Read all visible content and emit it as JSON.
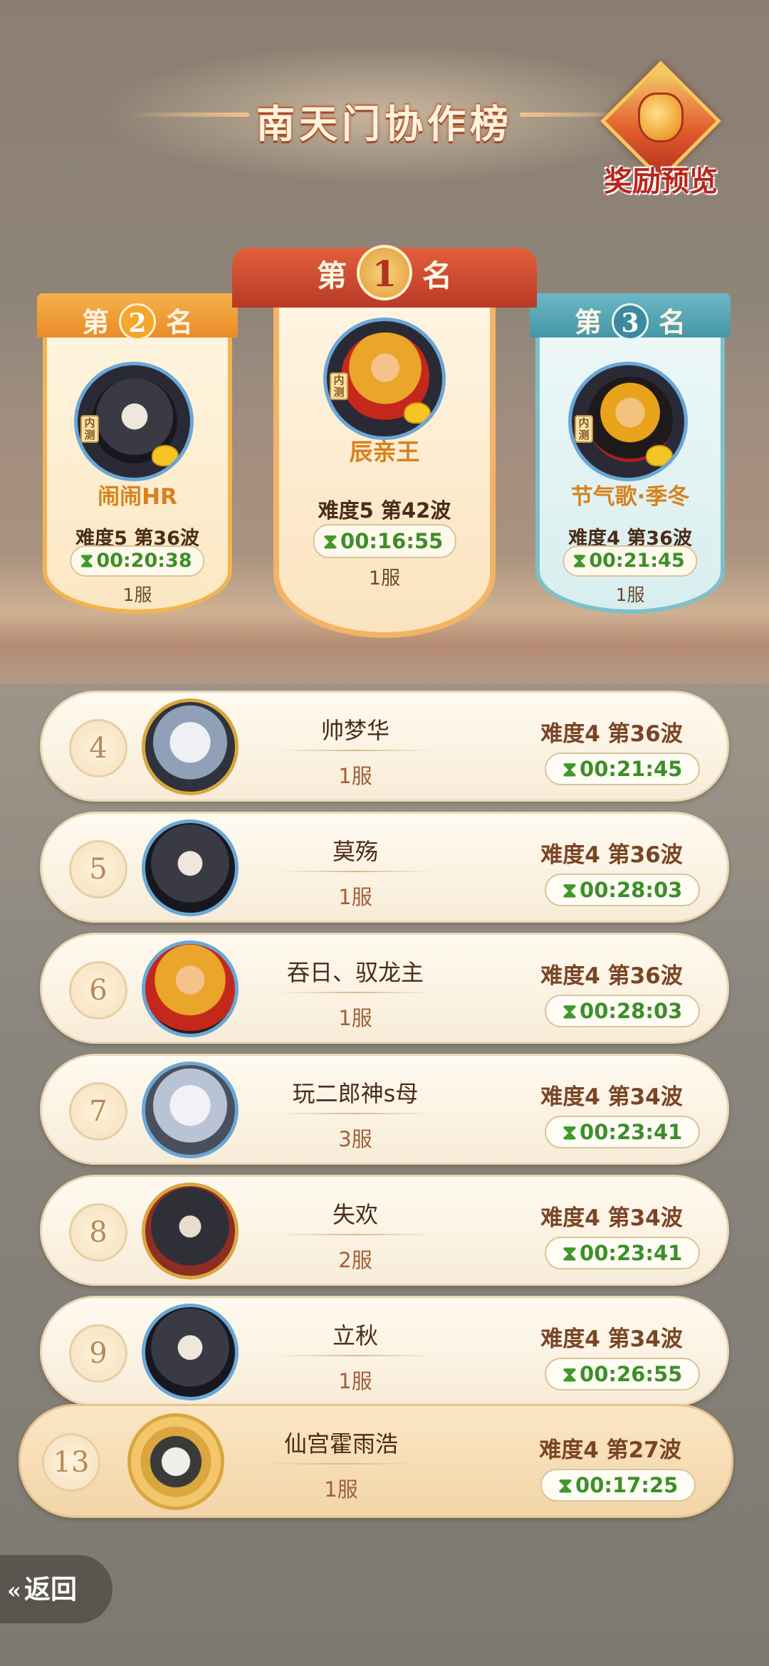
{
  "header": {
    "title": "南天门协作榜",
    "reward_label": "奖励预览"
  },
  "podium": {
    "first": {
      "rank_prefix": "第",
      "rank_num": "1",
      "rank_suffix": "名",
      "name": "辰亲王",
      "info": "难度5 第42波",
      "time": "00:16:55",
      "server": "1服"
    },
    "second": {
      "rank_prefix": "第",
      "rank_num": "2",
      "rank_suffix": "名",
      "name": "闹闹HR",
      "info": "难度5 第36波",
      "time": "00:20:38",
      "server": "1服"
    },
    "third": {
      "rank_prefix": "第",
      "rank_num": "3",
      "rank_suffix": "名",
      "name": "节气歌·季冬",
      "info": "难度4 第36波",
      "time": "00:21:45",
      "server": "1服"
    }
  },
  "avatar_tag": "内测",
  "hourglass_glyph": "⧗",
  "rows": [
    {
      "rank": "4",
      "name": "帅梦华",
      "server": "1服",
      "difficulty": "难度4 第36波",
      "time": "00:21:45"
    },
    {
      "rank": "5",
      "name": "莫殇",
      "server": "1服",
      "difficulty": "难度4 第36波",
      "time": "00:28:03"
    },
    {
      "rank": "6",
      "name": "吞日、驭龙主",
      "server": "1服",
      "difficulty": "难度4 第36波",
      "time": "00:28:03"
    },
    {
      "rank": "7",
      "name": "玩二郎神s母",
      "server": "3服",
      "difficulty": "难度4 第34波",
      "time": "00:23:41"
    },
    {
      "rank": "8",
      "name": "失欢",
      "server": "2服",
      "difficulty": "难度4 第34波",
      "time": "00:23:41"
    },
    {
      "rank": "9",
      "name": "立秋",
      "server": "1服",
      "difficulty": "难度4 第34波",
      "time": "00:26:55"
    }
  ],
  "my_row": {
    "rank": "13",
    "name": "仙宫霍雨浩",
    "server": "1服",
    "difficulty": "难度4 第27波",
    "time": "00:17:25"
  },
  "nav": {
    "back_label": "返回",
    "back_icon": "chevron-double-left-icon"
  },
  "colors": {
    "gold_banner": "#f0a33a",
    "red_banner": "#d8523a",
    "teal_banner": "#57a9b8",
    "timer_green": "#3d8e2a"
  }
}
